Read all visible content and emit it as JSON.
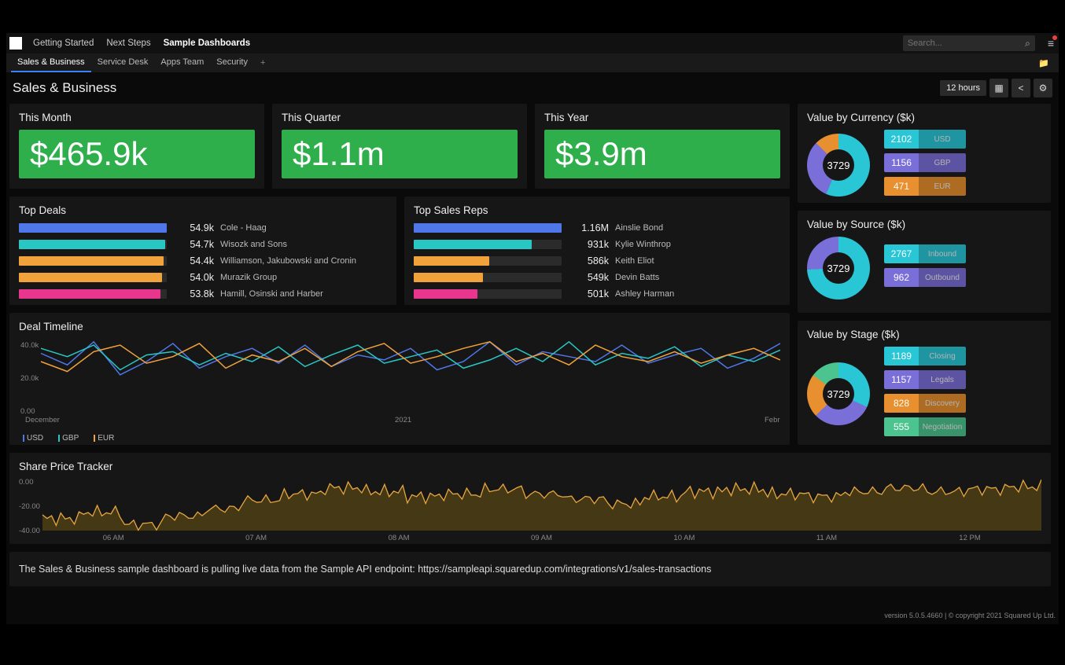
{
  "top_nav": {
    "items": [
      "Getting Started",
      "Next Steps",
      "Sample Dashboards"
    ],
    "active": 2
  },
  "search": {
    "placeholder": "Search..."
  },
  "tabs": {
    "items": [
      "Sales & Business",
      "Service Desk",
      "Apps Team",
      "Security"
    ],
    "active": 0
  },
  "page_title": "Sales & Business",
  "timerange": "12 hours",
  "kpis": [
    {
      "title": "This Month",
      "value": "$465.9k"
    },
    {
      "title": "This Quarter",
      "value": "$1.1m"
    },
    {
      "title": "This Year",
      "value": "$3.9m"
    }
  ],
  "top_deals": {
    "title": "Top Deals",
    "rows": [
      {
        "value": "54.9k",
        "label": "Cole - Haag",
        "pct": 100,
        "color": "#4f77ea"
      },
      {
        "value": "54.7k",
        "label": "Wisozk and Sons",
        "pct": 99,
        "color": "#28c7c4"
      },
      {
        "value": "54.4k",
        "label": "Williamson, Jakubowski and Cronin",
        "pct": 98,
        "color": "#f2a23a"
      },
      {
        "value": "54.0k",
        "label": "Murazik Group",
        "pct": 97,
        "color": "#f2a23a"
      },
      {
        "value": "53.8k",
        "label": "Hamill, Osinski and Harber",
        "pct": 96,
        "color": "#e8368f"
      }
    ]
  },
  "top_reps": {
    "title": "Top Sales Reps",
    "rows": [
      {
        "value": "1.16M",
        "label": "Ainslie Bond",
        "pct": 100,
        "color": "#4f77ea"
      },
      {
        "value": "931k",
        "label": "Kylie Winthrop",
        "pct": 80,
        "color": "#28c7c4"
      },
      {
        "value": "586k",
        "label": "Keith Eliot",
        "pct": 51,
        "color": "#f2a23a"
      },
      {
        "value": "549k",
        "label": "Devin Batts",
        "pct": 47,
        "color": "#f2a23a"
      },
      {
        "value": "501k",
        "label": "Ashley Harman",
        "pct": 43,
        "color": "#e8368f"
      }
    ]
  },
  "value_by_currency": {
    "title": "Value by Currency ($k)",
    "total": "3729",
    "items": [
      {
        "value": "2102",
        "label": "USD",
        "color": "#29c6d6"
      },
      {
        "value": "1156",
        "label": "GBP",
        "color": "#7a6fd8"
      },
      {
        "value": "471",
        "label": "EUR",
        "color": "#e8902f"
      }
    ]
  },
  "value_by_source": {
    "title": "Value by Source ($k)",
    "total": "3729",
    "items": [
      {
        "value": "2767",
        "label": "Inbound",
        "color": "#29c6d6"
      },
      {
        "value": "962",
        "label": "Outbound",
        "color": "#7a6fd8"
      }
    ]
  },
  "value_by_stage": {
    "title": "Value by Stage ($k)",
    "total": "3729",
    "items": [
      {
        "value": "1189",
        "label": "Closing",
        "color": "#29c6d6"
      },
      {
        "value": "1157",
        "label": "Legals",
        "color": "#7a6fd8"
      },
      {
        "value": "828",
        "label": "Discovery",
        "color": "#e8902f"
      },
      {
        "value": "555",
        "label": "Negotiation",
        "color": "#4bc48f"
      }
    ]
  },
  "deal_timeline": {
    "title": "Deal Timeline",
    "y_ticks": [
      "40.0k",
      "20.0k",
      "0.00"
    ],
    "x_ticks": [
      "December",
      "2021",
      "February"
    ],
    "legend": [
      "USD",
      "GBP",
      "EUR"
    ],
    "legend_colors": [
      "#4f77ea",
      "#28c7c4",
      "#f2a23a"
    ]
  },
  "share_price": {
    "title": "Share Price Tracker",
    "y_ticks": [
      "0.00",
      "-20.00",
      "-40.00"
    ],
    "x_ticks": [
      "06 AM",
      "07 AM",
      "08 AM",
      "09 AM",
      "10 AM",
      "11 AM",
      "12 PM"
    ]
  },
  "footer_note": "The Sales & Business sample dashboard is pulling live data from the Sample API endpoint: https://sampleapi.squaredup.com/integrations/v1/sales-transactions",
  "footer_copyright": "version 5.0.5.4660 | © copyright 2021 Squared Up Ltd.",
  "chart_data": [
    {
      "type": "bar",
      "title": "Top Deals",
      "categories": [
        "Cole - Haag",
        "Wisozk and Sons",
        "Williamson, Jakubowski and Cronin",
        "Murazik Group",
        "Hamill, Osinski and Harber"
      ],
      "values": [
        54.9,
        54.7,
        54.4,
        54.0,
        53.8
      ],
      "ylabel": "k"
    },
    {
      "type": "bar",
      "title": "Top Sales Reps",
      "categories": [
        "Ainslie Bond",
        "Kylie Winthrop",
        "Keith Eliot",
        "Devin Batts",
        "Ashley Harman"
      ],
      "values": [
        1160,
        931,
        586,
        549,
        501
      ],
      "ylabel": "k"
    },
    {
      "type": "pie",
      "title": "Value by Currency ($k)",
      "categories": [
        "USD",
        "GBP",
        "EUR"
      ],
      "values": [
        2102,
        1156,
        471
      ]
    },
    {
      "type": "pie",
      "title": "Value by Source ($k)",
      "categories": [
        "Inbound",
        "Outbound"
      ],
      "values": [
        2767,
        962
      ]
    },
    {
      "type": "pie",
      "title": "Value by Stage ($k)",
      "categories": [
        "Closing",
        "Legals",
        "Discovery",
        "Negotiation"
      ],
      "values": [
        1189,
        1157,
        828,
        555
      ]
    },
    {
      "type": "line",
      "title": "Deal Timeline",
      "x": [
        "December",
        "2021",
        "February"
      ],
      "ylim": [
        0,
        40
      ],
      "series": [
        {
          "name": "USD",
          "values": [
            35,
            28,
            42,
            22,
            30,
            41,
            26,
            33,
            38,
            29,
            40,
            27,
            34,
            31,
            38,
            25,
            30,
            42,
            28,
            36,
            33,
            30,
            40,
            29,
            34,
            38,
            26,
            32,
            41
          ]
        },
        {
          "name": "GBP",
          "values": [
            38,
            33,
            40,
            25,
            34,
            36,
            28,
            35,
            30,
            39,
            27,
            34,
            40,
            29,
            33,
            37,
            26,
            31,
            38,
            30,
            42,
            28,
            35,
            32,
            39,
            27,
            34,
            30,
            37
          ]
        },
        {
          "name": "EUR",
          "values": [
            30,
            24,
            36,
            40,
            29,
            33,
            41,
            26,
            34,
            30,
            38,
            27,
            36,
            41,
            29,
            33,
            38,
            42,
            30,
            35,
            28,
            40,
            33,
            30,
            36,
            29,
            34,
            38,
            31
          ]
        }
      ]
    },
    {
      "type": "area",
      "title": "Share Price Tracker",
      "x": [
        "06 AM",
        "07 AM",
        "08 AM",
        "09 AM",
        "10 AM",
        "11 AM",
        "12 PM"
      ],
      "ylim": [
        -40,
        0
      ],
      "series": [
        {
          "name": "price",
          "values": [
            -30,
            -25,
            -35,
            -28,
            -22,
            -15,
            -10,
            -5,
            -8,
            -12,
            -10,
            -6,
            -10,
            -14,
            -18,
            -12,
            -8,
            -6,
            -10,
            -12,
            -8,
            -5,
            -8,
            -6,
            -4
          ]
        }
      ]
    }
  ]
}
